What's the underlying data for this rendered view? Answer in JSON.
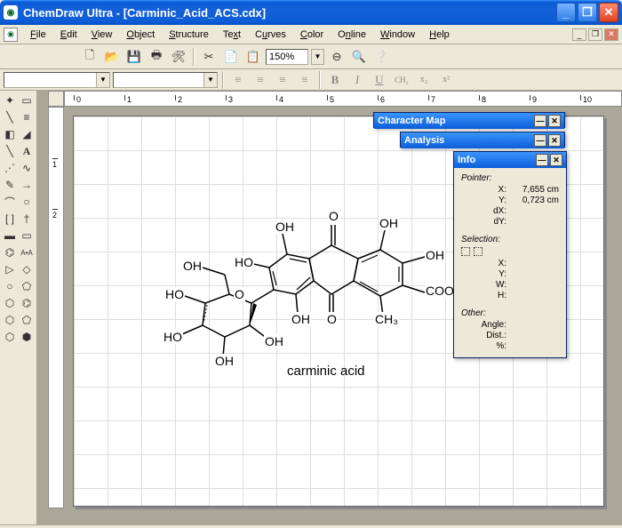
{
  "app": {
    "name": "ChemDraw Ultra",
    "document": "[Carminic_Acid_ACS.cdx]"
  },
  "menus": [
    "File",
    "Edit",
    "View",
    "Object",
    "Structure",
    "Text",
    "Curves",
    "Color",
    "Online",
    "Window",
    "Help"
  ],
  "toolbar": {
    "zoom": "150%"
  },
  "ruler_h": [
    "0",
    "1",
    "2",
    "3",
    "4",
    "5",
    "6",
    "7",
    "8",
    "9",
    "10"
  ],
  "ruler_v": [
    "1",
    "2"
  ],
  "panels": {
    "charmap": {
      "title": "Character Map"
    },
    "analysis": {
      "title": "Analysis"
    },
    "info": {
      "title": "Info",
      "pointer_label": "Pointer:",
      "x_label": "X:",
      "x_value": "7,655 cm",
      "y_label": "Y:",
      "y_value": "0,723 cm",
      "dx_label": "dX:",
      "dx_value": "",
      "dy_label": "dY:",
      "dy_value": "",
      "selection_label": "Selection:",
      "sx_label": "X:",
      "sy_label": "Y:",
      "w_label": "W:",
      "h_label": "H:",
      "other_label": "Other:",
      "angle_label": "Angle:",
      "dist_label": "Dist.:",
      "pct_label": "%:"
    }
  },
  "molecule": {
    "title": "carminic acid",
    "labels": {
      "oh1": "OH",
      "oh2": "OH",
      "oh3": "OH",
      "oh4": "OH",
      "oh5": "OH",
      "oh6": "OH",
      "oh7": "OH",
      "ho1": "HO",
      "ho2": "HO",
      "ho3": "HO",
      "o1": "O",
      "o2": "O",
      "o3": "O",
      "cooh": "COOH",
      "ch3": "CH₃"
    }
  }
}
